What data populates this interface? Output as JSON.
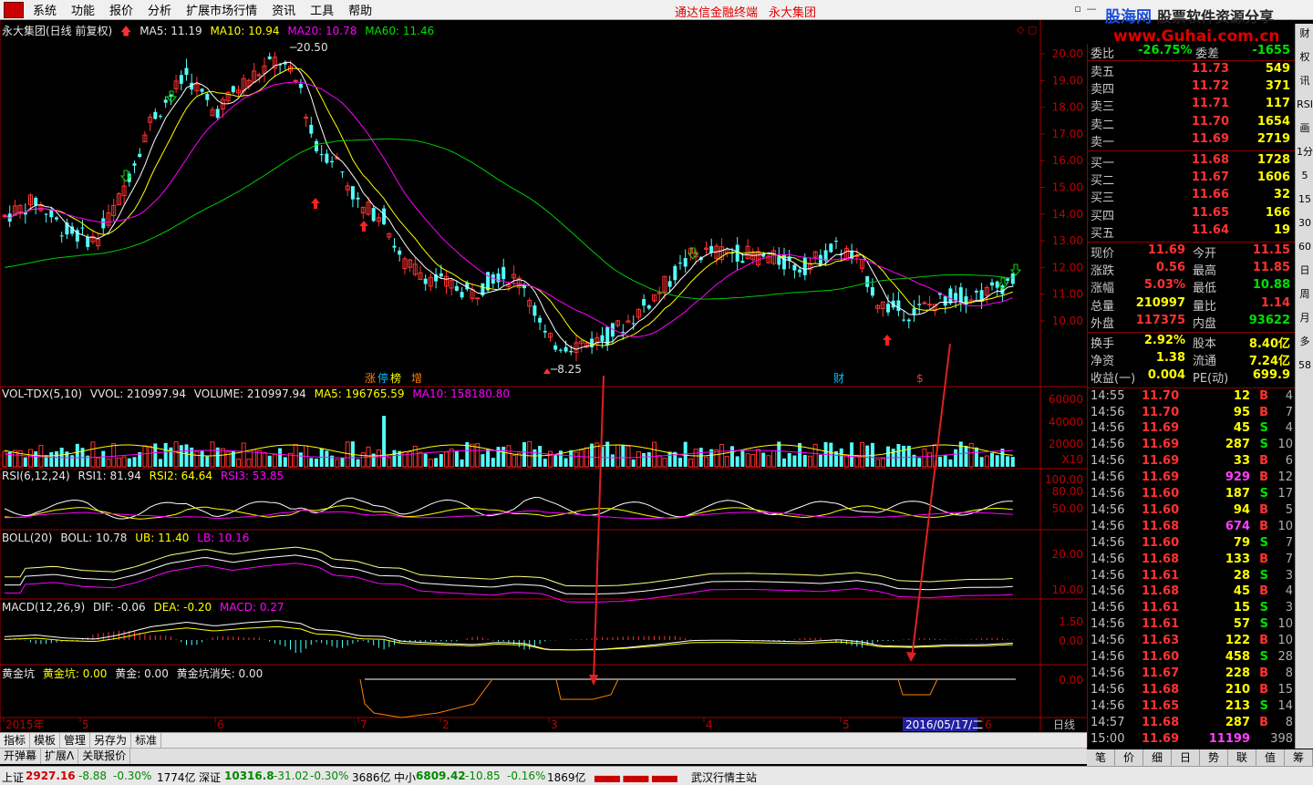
{
  "menu": {
    "items": [
      "系统",
      "功能",
      "报价",
      "分析",
      "扩展市场行情",
      "资讯",
      "工具",
      "帮助"
    ],
    "center_title": "通达信金融终端",
    "company": "永大集团"
  },
  "brand": {
    "name": "股海网",
    "slogan": "股票软件资源分享",
    "url": "www.Guhai.com.cn"
  },
  "main_header": {
    "title": "永大集团(日线 前复权)",
    "ma5": "MA5: 11.19",
    "ma10": "MA10: 10.94",
    "ma20": "MA20: 10.78",
    "ma60": "MA60: 11.46",
    "high_label": "20.50",
    "low_label": "8.25",
    "colors": {
      "ma5": "#ffffff",
      "ma10": "#ffff00",
      "ma20": "#ff00ff",
      "ma60": "#00cc00"
    }
  },
  "price_axis": [
    "20.00",
    "19.00",
    "18.00",
    "17.00",
    "16.00",
    "15.00",
    "14.00",
    "13.00",
    "12.00",
    "11.00",
    "10.00"
  ],
  "event_markers": [
    "涨",
    "停",
    "榜",
    "增",
    "财",
    "$"
  ],
  "vol": {
    "header": "VOL-TDX(5,10)",
    "vvol": "VVOL: 210997.94",
    "volume": "VOLUME: 210997.94",
    "ma5": "MA5: 196765.59",
    "ma10": "MA10: 158180.80",
    "axis": [
      "60000",
      "40000",
      "20000"
    ],
    "unit": "X10"
  },
  "rsi": {
    "header": "RSI(6,12,24)",
    "rsi1": "RSI1: 81.94",
    "rsi2": "RSI2: 64.64",
    "rsi3": "RSI3: 53.85",
    "axis": [
      "100.00",
      "80.00",
      "50.00"
    ]
  },
  "boll": {
    "header": "BOLL(20)",
    "boll": "BOLL: 10.78",
    "ub": "UB: 11.40",
    "lb": "LB: 10.16",
    "axis": [
      "20.00",
      "10.00"
    ]
  },
  "macd": {
    "header": "MACD(12,26,9)",
    "dif": "DIF: -0.06",
    "dea": "DEA: -0.20",
    "macd": "MACD: 0.27",
    "axis": [
      "1.50",
      "0.00"
    ]
  },
  "gold": {
    "header": "黄金坑",
    "pit": "黄金坑: 0.00",
    "gold": "黄金: 0.00",
    "vanish": "黄金坑消失: 0.00",
    "axis": [
      "0.00"
    ]
  },
  "time_axis": {
    "labels": [
      "2015年",
      "5",
      "6",
      "7",
      "2",
      "3",
      "4",
      "5",
      "6"
    ],
    "cursor_date": "2016/05/17/二",
    "period": "日线"
  },
  "quote": {
    "weibi": {
      "label": "委比",
      "value": "-26.75%",
      "label2": "委差",
      "value2": "-1655"
    },
    "asks": [
      {
        "label": "卖五",
        "price": "11.73",
        "vol": "549"
      },
      {
        "label": "卖四",
        "price": "11.72",
        "vol": "371"
      },
      {
        "label": "卖三",
        "price": "11.71",
        "vol": "117"
      },
      {
        "label": "卖二",
        "price": "11.70",
        "vol": "1654"
      },
      {
        "label": "卖一",
        "price": "11.69",
        "vol": "2719"
      }
    ],
    "bids": [
      {
        "label": "买一",
        "price": "11.68",
        "vol": "1728"
      },
      {
        "label": "买二",
        "price": "11.67",
        "vol": "1606"
      },
      {
        "label": "买三",
        "price": "11.66",
        "vol": "32"
      },
      {
        "label": "买四",
        "price": "11.65",
        "vol": "166"
      },
      {
        "label": "买五",
        "price": "11.64",
        "vol": "19"
      }
    ],
    "stats": [
      {
        "l1": "现价",
        "v1": "11.69",
        "l2": "今开",
        "v2": "11.15",
        "c1": "#ff3232",
        "c2": "#ff3232"
      },
      {
        "l1": "涨跌",
        "v1": "0.56",
        "l2": "最高",
        "v2": "11.85",
        "c1": "#ff3232",
        "c2": "#ff3232"
      },
      {
        "l1": "涨幅",
        "v1": "5.03%",
        "l2": "最低",
        "v2": "10.88",
        "c1": "#ff3232",
        "c2": "#00e000"
      },
      {
        "l1": "总量",
        "v1": "210997",
        "l2": "量比",
        "v2": "1.14",
        "c1": "#ffff00",
        "c2": "#ff3232"
      },
      {
        "l1": "外盘",
        "v1": "117375",
        "l2": "内盘",
        "v2": "93622",
        "c1": "#ff3232",
        "c2": "#00e000"
      },
      {
        "l1": "换手",
        "v1": "2.92%",
        "l2": "股本",
        "v2": "8.40亿",
        "c1": "#ffff00",
        "c2": "#ffff00"
      },
      {
        "l1": "净资",
        "v1": "1.38",
        "l2": "流通",
        "v2": "7.24亿",
        "c1": "#ffff00",
        "c2": "#ffff00"
      },
      {
        "l1": "收益(一)",
        "v1": "0.004",
        "l2": "PE(动)",
        "v2": "699.9",
        "c1": "#ffff00",
        "c2": "#ffff00"
      }
    ]
  },
  "ticks": [
    {
      "t": "14:55",
      "p": "11.70",
      "v": "12",
      "d": "B",
      "n": "4"
    },
    {
      "t": "14:56",
      "p": "11.70",
      "v": "95",
      "d": "B",
      "n": "7"
    },
    {
      "t": "14:56",
      "p": "11.69",
      "v": "45",
      "d": "S",
      "n": "4"
    },
    {
      "t": "14:56",
      "p": "11.69",
      "v": "287",
      "d": "S",
      "n": "10"
    },
    {
      "t": "14:56",
      "p": "11.69",
      "v": "33",
      "d": "B",
      "n": "6"
    },
    {
      "t": "14:56",
      "p": "11.69",
      "v": "929",
      "d": "B",
      "n": "12"
    },
    {
      "t": "14:56",
      "p": "11.60",
      "v": "187",
      "d": "S",
      "n": "17"
    },
    {
      "t": "14:56",
      "p": "11.60",
      "v": "94",
      "d": "B",
      "n": "5"
    },
    {
      "t": "14:56",
      "p": "11.68",
      "v": "674",
      "d": "B",
      "n": "10"
    },
    {
      "t": "14:56",
      "p": "11.60",
      "v": "79",
      "d": "S",
      "n": "7"
    },
    {
      "t": "14:56",
      "p": "11.68",
      "v": "133",
      "d": "B",
      "n": "7"
    },
    {
      "t": "14:56",
      "p": "11.61",
      "v": "28",
      "d": "S",
      "n": "3"
    },
    {
      "t": "14:56",
      "p": "11.68",
      "v": "45",
      "d": "B",
      "n": "4"
    },
    {
      "t": "14:56",
      "p": "11.61",
      "v": "15",
      "d": "S",
      "n": "3"
    },
    {
      "t": "14:56",
      "p": "11.61",
      "v": "57",
      "d": "S",
      "n": "10"
    },
    {
      "t": "14:56",
      "p": "11.63",
      "v": "122",
      "d": "B",
      "n": "10"
    },
    {
      "t": "14:56",
      "p": "11.60",
      "v": "458",
      "d": "S",
      "n": "28"
    },
    {
      "t": "14:56",
      "p": "11.67",
      "v": "228",
      "d": "B",
      "n": "8"
    },
    {
      "t": "14:56",
      "p": "11.68",
      "v": "210",
      "d": "B",
      "n": "15"
    },
    {
      "t": "14:56",
      "p": "11.65",
      "v": "213",
      "d": "S",
      "n": "14"
    },
    {
      "t": "14:57",
      "p": "11.68",
      "v": "287",
      "d": "B",
      "n": "8"
    },
    {
      "t": "15:00",
      "p": "11.69",
      "v": "11199",
      "d": "",
      "n": "398"
    }
  ],
  "sidebar": [
    "财",
    "权",
    "讯",
    "RSI",
    "画",
    "1分",
    "5",
    "15",
    "30",
    "60",
    "日",
    "周",
    "月",
    "多",
    "58"
  ],
  "bottom_tabs": [
    "笔",
    "价",
    "细",
    "日",
    "势",
    "联",
    "值",
    "筹"
  ],
  "toolrow": [
    "指标",
    "模板",
    "管理",
    "另存为",
    "标准"
  ],
  "toolrow2": [
    "开弹幕",
    "扩展Λ",
    "关联报价"
  ],
  "status": {
    "sh": "上证",
    "sh_val": "2927.16",
    "sh_chg": "-8.88",
    "sh_pct": "-0.30%",
    "sh_amt": "1774亿",
    "sz": "深证",
    "sz_val": "10316.8",
    "sz_chg": "-31.02",
    "sz_pct": "-0.30%",
    "sz_amt": "3686亿",
    "zx": "中小",
    "zx_val": "6809.42",
    "zx_chg": "-10.85",
    "zx_pct": "-0.16%",
    "zx_amt": "1869亿",
    "site": "武汉行情主站"
  }
}
